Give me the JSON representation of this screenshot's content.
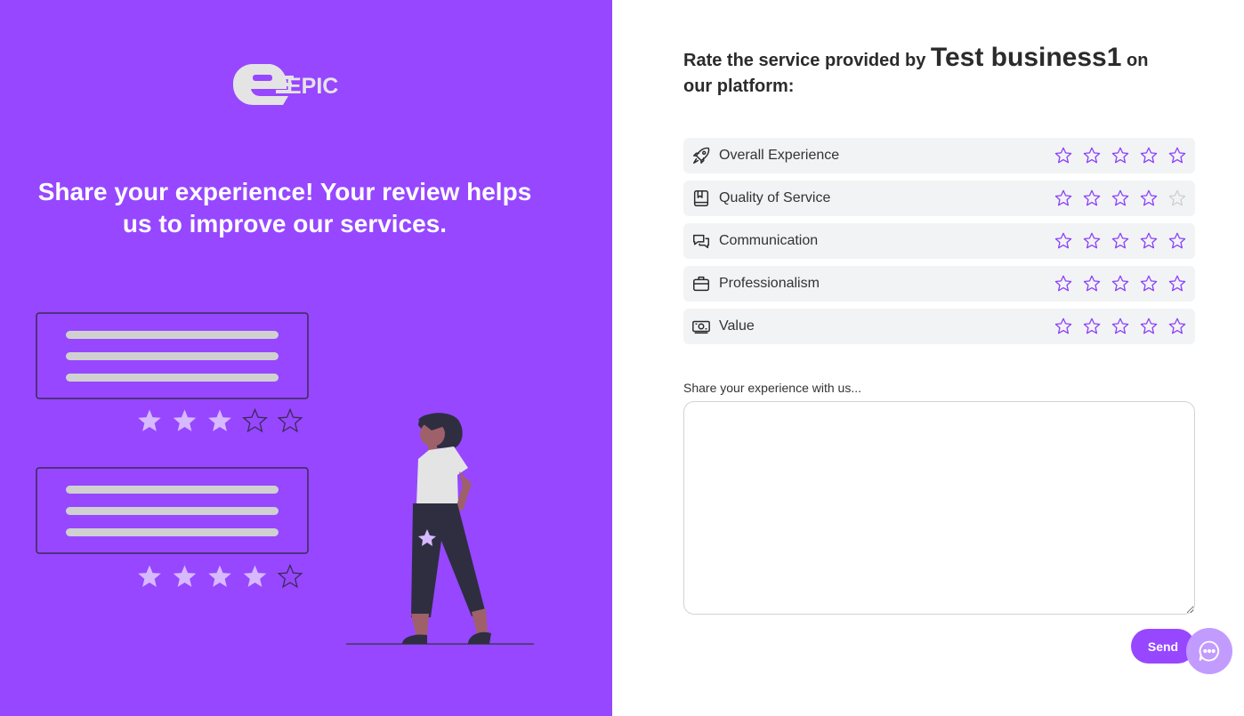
{
  "brand": {
    "logo_text": "EPIC",
    "logo_icon": "e-mark-logo"
  },
  "left": {
    "tagline": "Share your experience! Your review helps us to improve our services."
  },
  "illustration": {
    "cards": [
      {
        "stars_filled": 3,
        "stars_total": 5
      },
      {
        "stars_filled": 4,
        "stars_total": 5
      }
    ]
  },
  "form": {
    "heading_prefix": "Rate the service provided by",
    "business_name": "Test business1",
    "heading_suffix": "on our platform:",
    "categories": [
      {
        "label": "Overall Experience",
        "icon": "rocket-icon",
        "stars_active": 5
      },
      {
        "label": "Quality of Service",
        "icon": "book-icon",
        "stars_active": 4
      },
      {
        "label": "Communication",
        "icon": "chat-bubbles-icon",
        "stars_active": 5
      },
      {
        "label": "Professionalism",
        "icon": "briefcase-icon",
        "stars_active": 5
      },
      {
        "label": "Value",
        "icon": "money-icon",
        "stars_active": 5
      }
    ],
    "textarea_label": "Share your experience with us...",
    "textarea_value": "",
    "textarea_placeholder": "",
    "send_label": "Send"
  },
  "colors": {
    "brand_purple": "#9747ff",
    "star_outline": "#8a3ffc",
    "star_inactive": "#cfcfcf",
    "row_background": "#f2f3f4",
    "chat_button": "#c29bff"
  }
}
